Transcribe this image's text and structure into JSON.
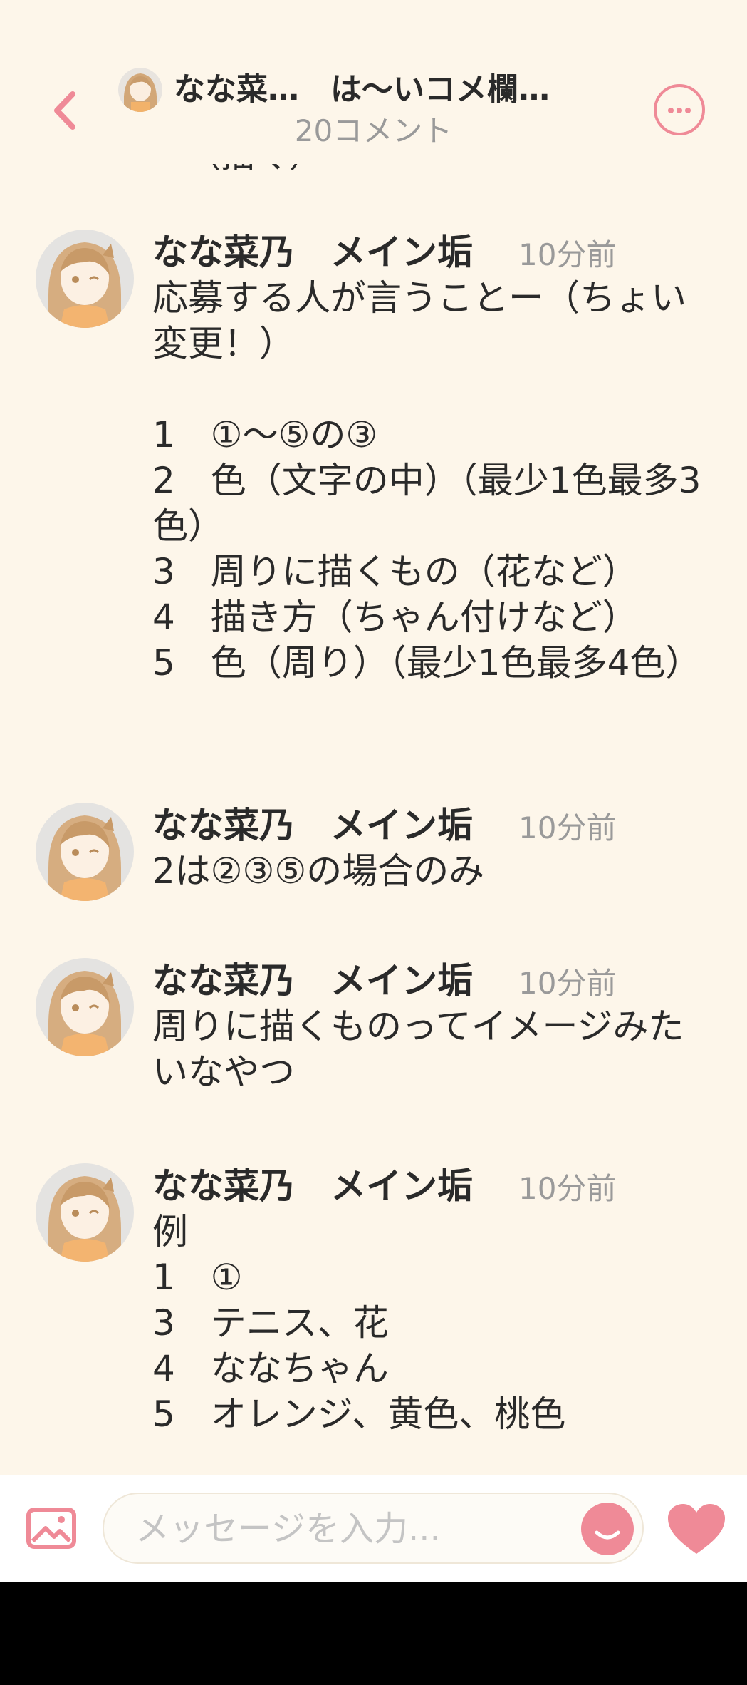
{
  "header": {
    "title": "なな菜…　は〜いコメ欄…",
    "subtitle": "20コメント",
    "back_icon": "chevron-left-icon",
    "more_icon": "more-horizontal-icon"
  },
  "comments": [
    {
      "name": "なな菜乃　メイン垢",
      "time": "10分前",
      "body": "応募する人が言うことー（ちょい変更！）\n\n1　①〜⑤の③\n2　色（文字の中）（最少1色最多3色）\n3　周りに描くもの（花など）\n4　描き方（ちゃん付けなど）\n5　色（周り）（最少1色最多4色）"
    },
    {
      "name": "なな菜乃　メイン垢",
      "time": "10分前",
      "body": "2は②③⑤の場合のみ"
    },
    {
      "name": "なな菜乃　メイン垢",
      "time": "10分前",
      "body": "周りに描くものってイメージみたいなやつ"
    },
    {
      "name": "なな菜乃　メイン垢",
      "time": "10分前",
      "body": "例\n1　①\n3　テニス、花\n4　ななちゃん\n5　オレンジ、黄色、桃色"
    }
  ],
  "composer": {
    "placeholder": "メッセージを入力...",
    "image_icon": "image-icon",
    "emoji_icon": "emoji-icon",
    "like_icon": "heart-icon"
  },
  "colors": {
    "background": "#fdf6ea",
    "accent": "#ef8a97",
    "muted_text": "#9a9a9a"
  }
}
